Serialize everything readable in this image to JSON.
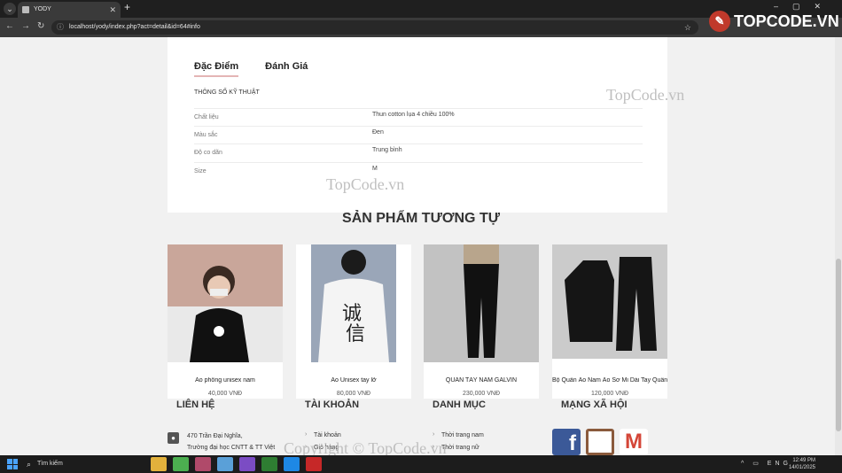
{
  "browser": {
    "tab_title": "YODY",
    "url": "localhost/yody/index.php?act=detail&id=64#info",
    "brand": "TOPCODE.VN"
  },
  "detail": {
    "tabs": [
      "Đặc Điểm",
      "Đánh Giá"
    ],
    "spec_title": "THÔNG SỐ KỸ THUẬT",
    "specs": [
      {
        "k": "Chất liệu",
        "v": "Thun cotton lụa 4 chiều 100%"
      },
      {
        "k": "Màu sắc",
        "v": "Đen"
      },
      {
        "k": "Độ co dãn",
        "v": "Trung bình"
      },
      {
        "k": "Size",
        "v": "M"
      }
    ]
  },
  "similar": {
    "title": "SẢN PHẨM TƯƠNG TỰ",
    "products": [
      {
        "name": "Áo phông unisex nam",
        "price": "40,000 VNĐ"
      },
      {
        "name": "Áo Unisex tay lỡ",
        "price": "80,000 VNĐ"
      },
      {
        "name": "QUẦN TÂY NAM GALVIN",
        "price": "230,000 VNĐ"
      },
      {
        "name": "Bộ Quần Áo Nam Áo Sơ Mi Dài Tay Quần",
        "price": "120,000 VNĐ"
      }
    ]
  },
  "footer": {
    "contact_title": "LIÊN HỆ",
    "contact_lines": [
      "470 Trần Đại Nghĩa,",
      "Trường đại học CNTT & TT Việt"
    ],
    "account_title": "TÀI KHOẢN",
    "account_items": [
      "Tài khoản",
      "Giỏ hàng"
    ],
    "category_title": "DANH MỤC",
    "category_items": [
      "Thời trang nam",
      "Thời trang nữ"
    ],
    "social_title": "MẠNG XÃ HỘI"
  },
  "watermarks": [
    "TopCode.vn",
    "TopCode.vn",
    "Copyright © TopCode.vn"
  ],
  "taskbar": {
    "search": "Tìm kiếm",
    "lang": "ENG",
    "time": "12:49 PM",
    "date": "14/01/2025"
  }
}
